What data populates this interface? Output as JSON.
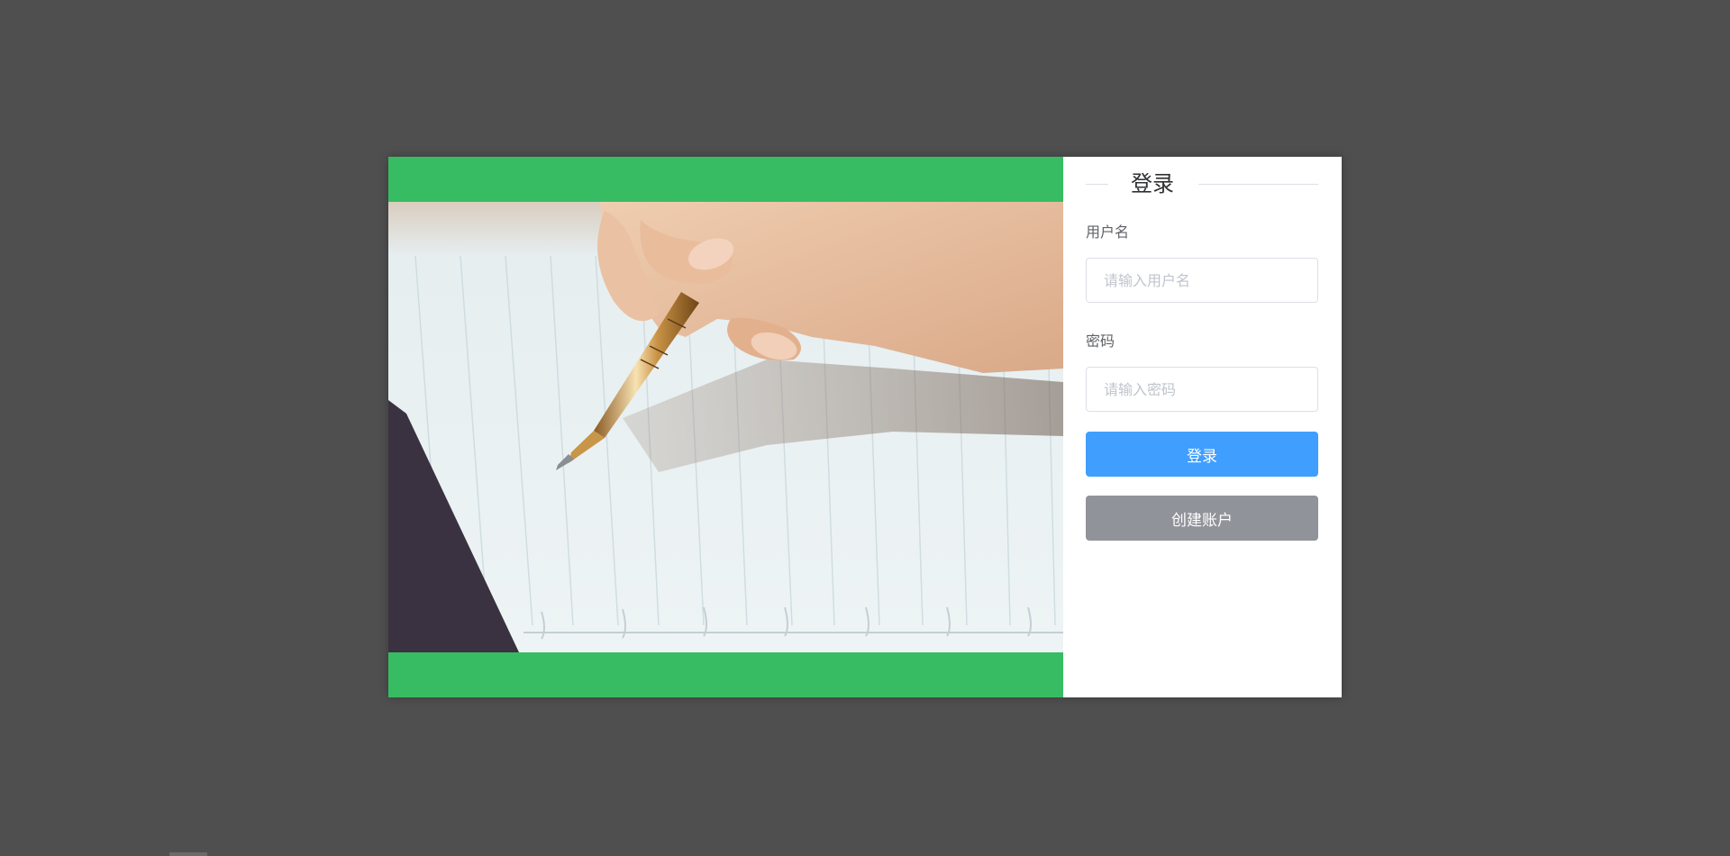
{
  "login": {
    "title": "登录",
    "username_label": "用户名",
    "username_placeholder": "请输入用户名",
    "username_value": "",
    "password_label": "密码",
    "password_placeholder": "请输入密码",
    "password_value": "",
    "login_button": "登录",
    "create_account_button": "创建账户"
  },
  "colors": {
    "page_background": "#4f4f4f",
    "left_panel_green": "#37bc63",
    "primary_button": "#409eff",
    "secondary_button": "#909399"
  },
  "icons": {
    "hero_image": "hand-writing-with-pen-photo"
  }
}
